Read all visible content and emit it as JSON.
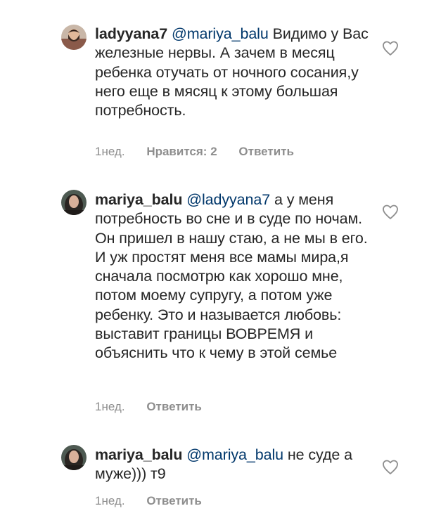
{
  "comments": [
    {
      "username": "ladyyana7",
      "mention": "@mariya_balu",
      "text": "Видимо у Вас железные нервы. А зачем в месяц ребенка отучать от ночного сосания,у него еще в мясяц к этому большая потребность.",
      "time": "1нед.",
      "likes": "Нравится: 2",
      "reply": "Ответить",
      "avatar": "man-with-beard-avatar"
    },
    {
      "username": "mariya_balu",
      "mention": "@ladyyana7",
      "text": "а у меня потребность во сне и в суде по ночам. Он пришел в нашу стаю, а не мы в его. И уж простят меня все мамы мира,я сначала посмотрю как хорошо мне, потом моему супругу, а потом уже ребенку. Это и называется любовь: выставит границы ВОВРЕМЯ и объяснить что к чему в этой семье",
      "time": "1нед.",
      "reply": "Ответить",
      "avatar": "woman-avatar"
    },
    {
      "username": "mariya_balu",
      "mention": "@mariya_balu",
      "text": "не суде а муже))) т9",
      "time": "1нед.",
      "reply": "Ответить",
      "avatar": "woman-avatar"
    }
  ],
  "icons": {
    "like": "heart-outline-icon"
  },
  "colors": {
    "text": "#262626",
    "mention": "#00376b",
    "meta": "#8e8e8e"
  }
}
